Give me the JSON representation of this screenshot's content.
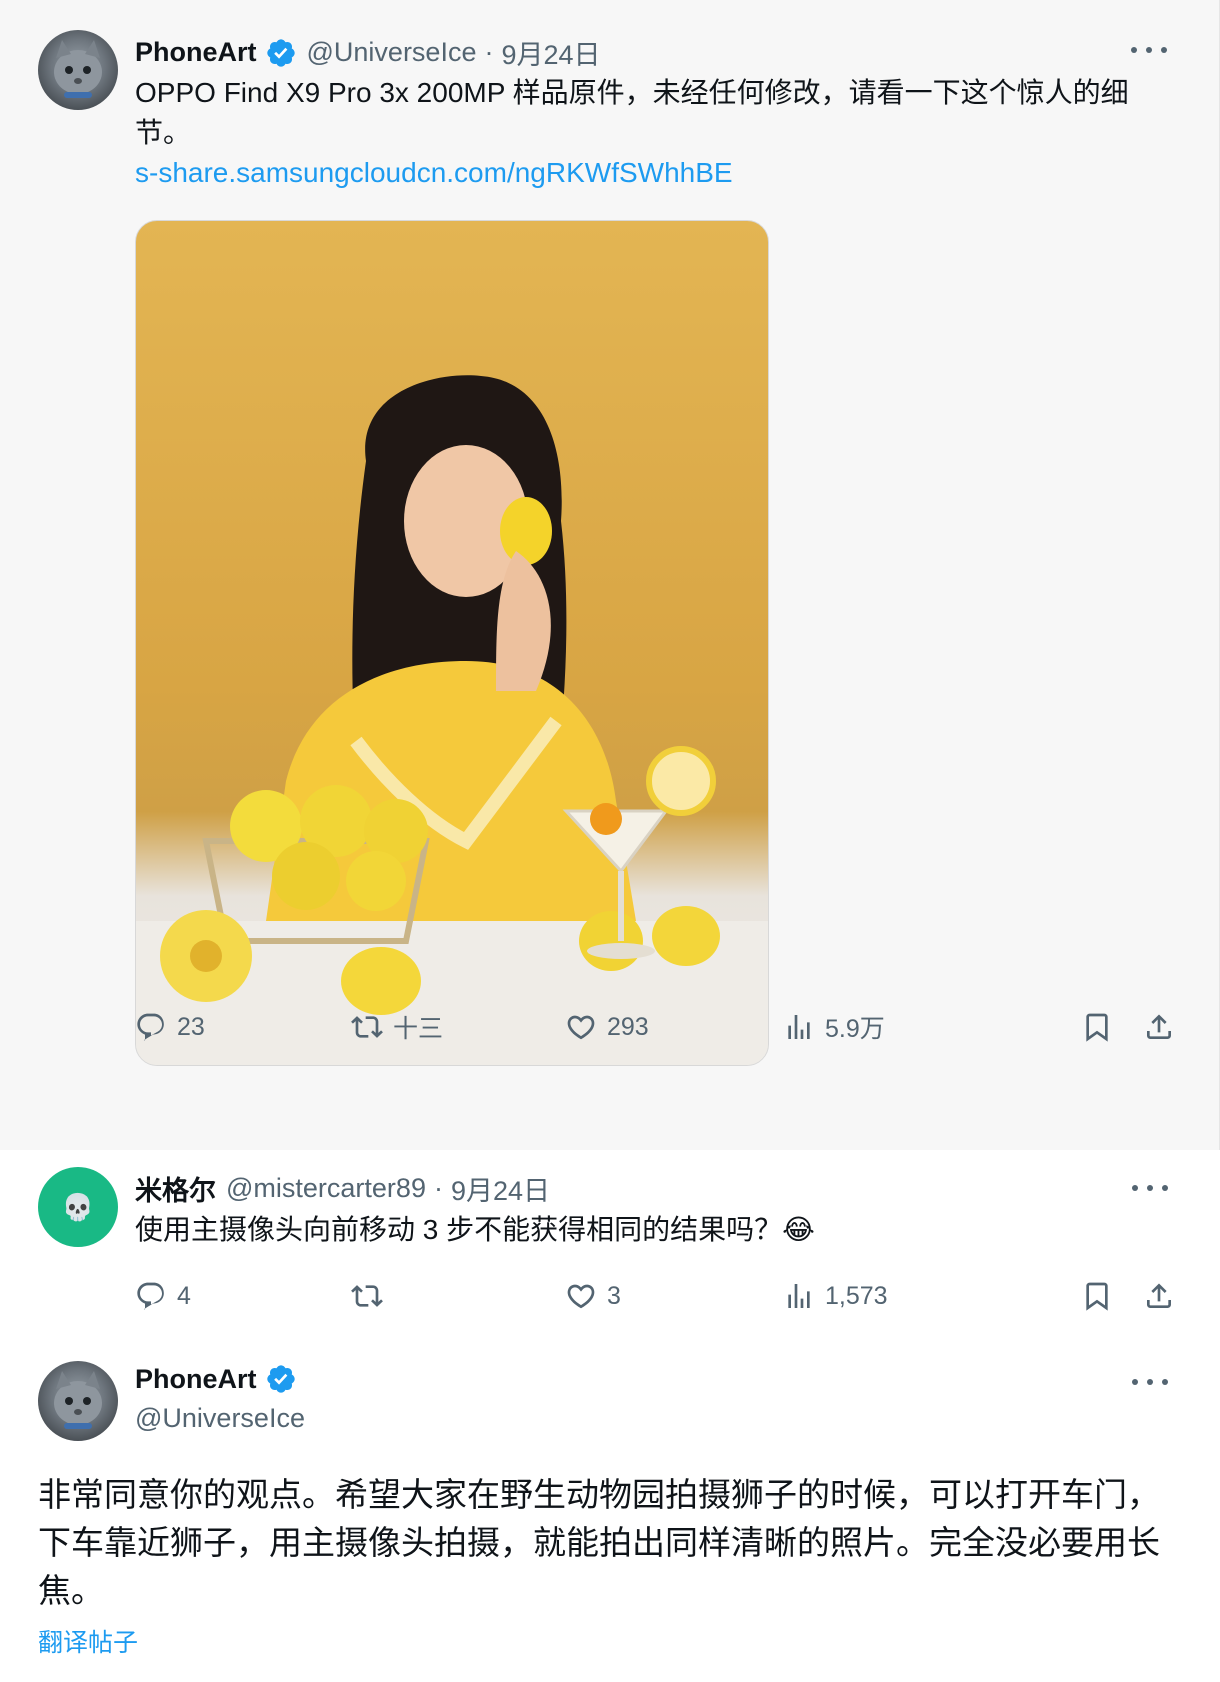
{
  "post1": {
    "author": "PhoneArt",
    "handle": "@UniverseIce",
    "separator": "·",
    "date": "9月24日",
    "text": "OPPO Find X9 Pro 3x 200MP 样品原件，未经任何修改，请看一下这个惊人的细节。",
    "link": "s-share.samsungcloudcn.com/ngRKWfSWhhBE",
    "stats": {
      "replies": "23",
      "reposts": "十三",
      "likes": "293",
      "views": "5.9万"
    }
  },
  "post2": {
    "author": "米格尔",
    "handle": "@mistercarter89",
    "separator": "·",
    "date": "9月24日",
    "text": "使用主摄像头向前移动 3 步不能获得相同的结果吗？😂",
    "stats": {
      "replies": "4",
      "reposts": "",
      "likes": "3",
      "views": "1,573"
    }
  },
  "post3": {
    "author": "PhoneArt",
    "handle": "@UniverseIce",
    "text": "非常同意你的观点。希望大家在野生动物园拍摄狮子的时候，可以打开车门，下车靠近狮子，用主摄像头拍摄，就能拍出同样清晰的照片。完全没必要用长焦。",
    "translate": "翻译帖子"
  },
  "colors": {
    "accent": "#1d9bf0",
    "muted": "#536471",
    "text": "#0f1419",
    "focus_bg": "#f7f7f7"
  },
  "icons": {
    "verified": "verified-badge-icon",
    "more": "more-icon",
    "reply": "reply-icon",
    "repost": "repost-icon",
    "like": "heart-icon",
    "views": "views-icon",
    "bookmark": "bookmark-icon",
    "share": "share-icon"
  }
}
